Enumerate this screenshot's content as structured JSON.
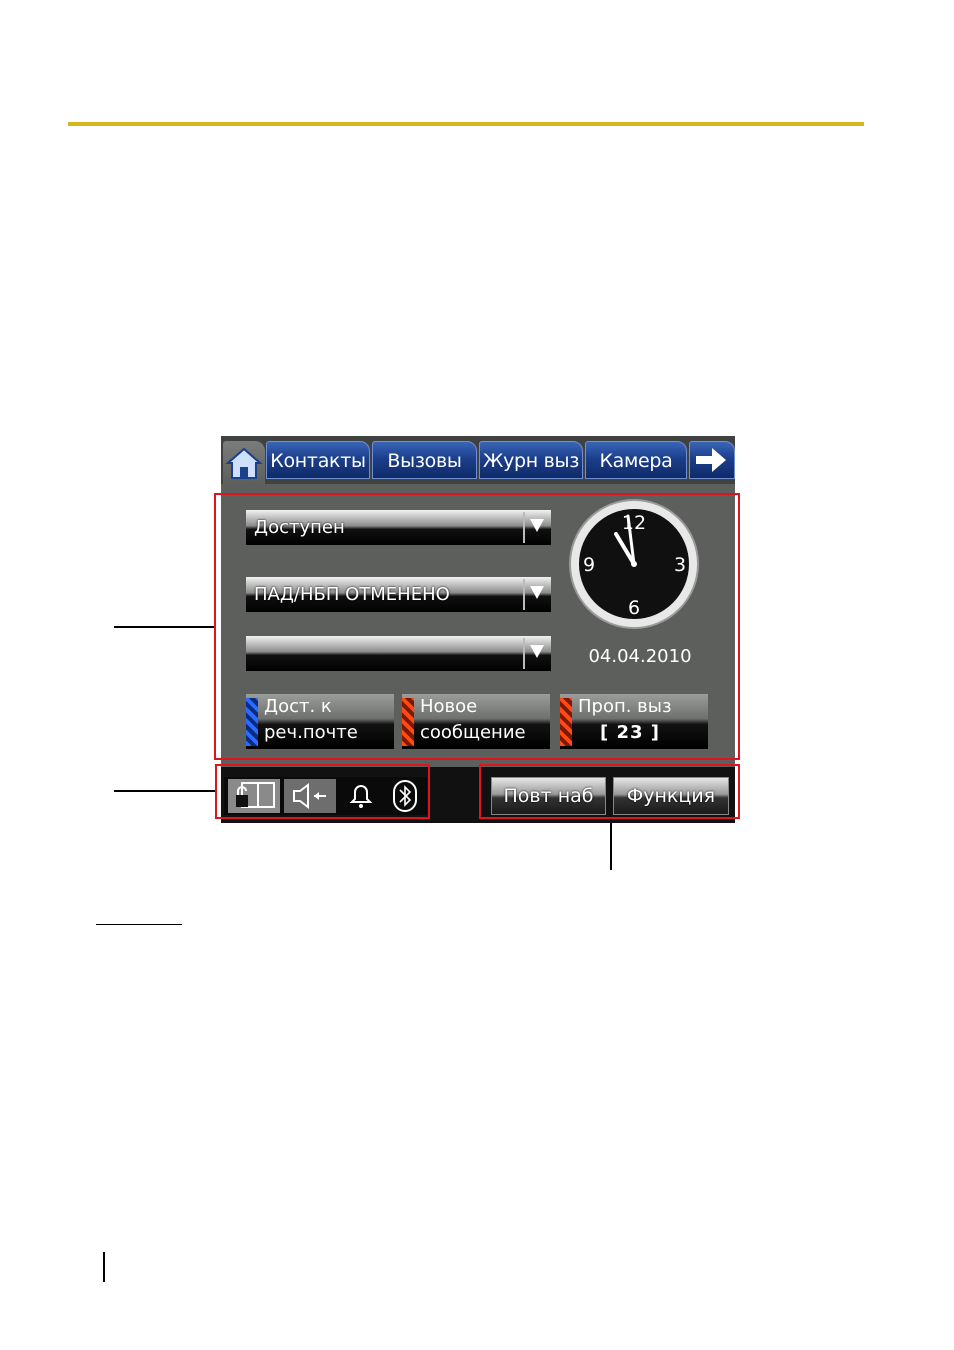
{
  "tabs": [
    "Контакты",
    "Вызовы",
    "Журн выз",
    "Камера"
  ],
  "dropdowns": [
    {
      "value": "Доступен"
    },
    {
      "value": "ПАД/НБП ОТМЕНЕНО"
    },
    {
      "value": ""
    }
  ],
  "clock": {
    "numerals": [
      "12",
      "3",
      "6",
      "9"
    ]
  },
  "date": "04.04.2010",
  "messages": [
    {
      "line1": "Дост. к",
      "line2": "реч.почте",
      "stripe_color": "#2a6cff"
    },
    {
      "line1": "Новое",
      "line2": "сообщение",
      "stripe_color": "#ff4a14"
    },
    {
      "line1": "Проп. выз",
      "count": "[ 23 ]",
      "stripe_color": "#ff4a14"
    }
  ],
  "status_icons": [
    "lock-book-icon",
    "speaker-icon",
    "bell-icon",
    "bluetooth-icon"
  ],
  "function_buttons": {
    "redial": "Повт наб",
    "function": "Функция"
  },
  "colors": {
    "tab_blue": "#1c3f8c",
    "highlight_red": "#e0141e",
    "rule_yellow": "#d4b81e"
  }
}
